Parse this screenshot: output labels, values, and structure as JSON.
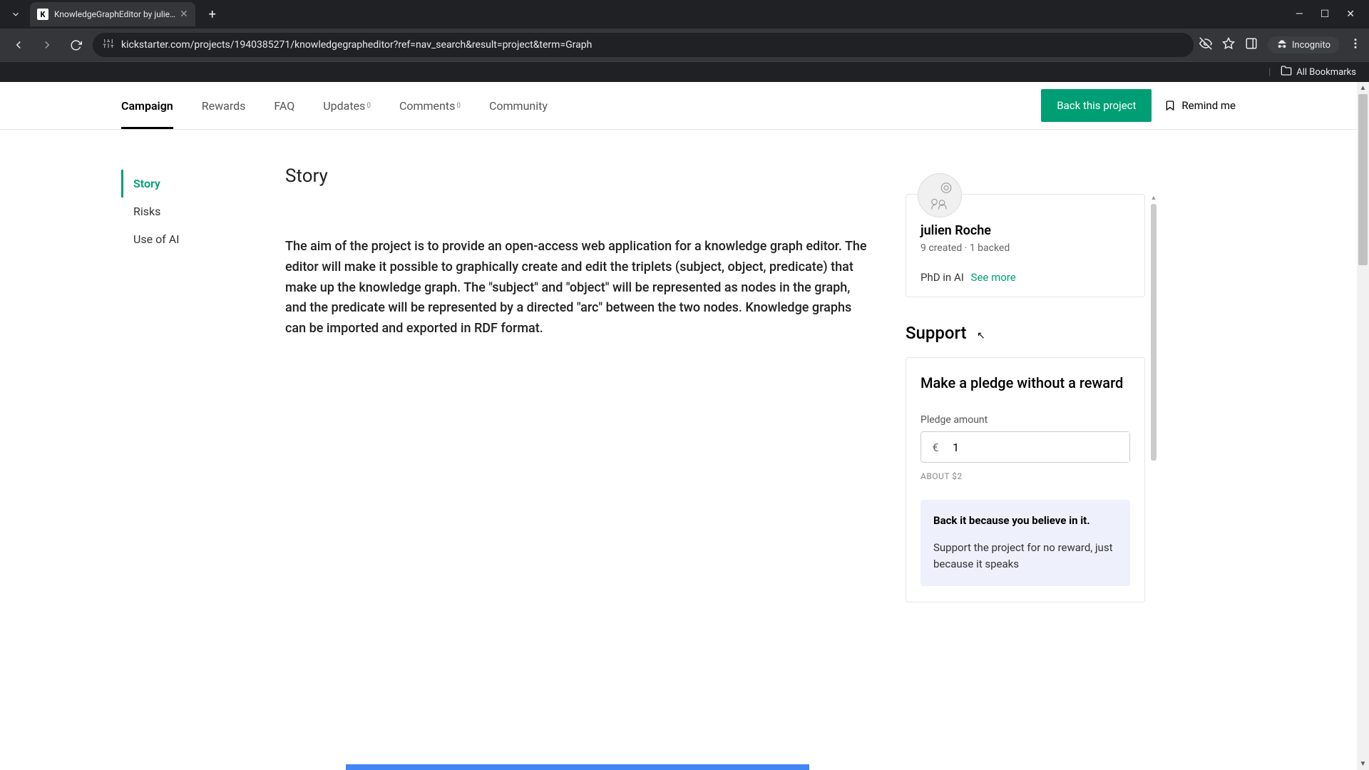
{
  "browser": {
    "tab_title": "KnowledgeGraphEditor by julie…",
    "url": "kickstarter.com/projects/1940385271/knowledgegrapheditor?ref=nav_search&result=project&term=Graph",
    "incognito_label": "Incognito",
    "all_bookmarks": "All Bookmarks"
  },
  "nav": {
    "tabs": {
      "campaign": "Campaign",
      "rewards": "Rewards",
      "faq": "FAQ",
      "updates": "Updates",
      "updates_count": "0",
      "comments": "Comments",
      "comments_count": "0",
      "community": "Community"
    },
    "back_button": "Back this project",
    "remind_button": "Remind me"
  },
  "sidebar": {
    "story": "Story",
    "risks": "Risks",
    "use_of_ai": "Use of AI"
  },
  "story": {
    "heading": "Story",
    "body": "The aim of the project is to provide an open-access web application for a knowledge graph editor. The editor will make it possible to graphically create and edit the triplets (subject, object, predicate) that make up the knowledge graph. The \"subject\" and \"object\" will be represented as nodes in the graph, and the predicate will be represented by a directed \"arc\" between the two nodes. Knowledge graphs can be imported and exported in RDF format."
  },
  "creator": {
    "name": "julien Roche",
    "stats": "9 created · 1 backed",
    "bio": "PhD in AI",
    "see_more": "See more"
  },
  "support": {
    "heading": "Support",
    "pledge_title": "Make a pledge without a reward",
    "pledge_label": "Pledge amount",
    "currency": "€",
    "amount": "1",
    "about": "ABOUT $2",
    "info_title": "Back it because you believe in it.",
    "info_body": "Support the project for no reward, just because it speaks"
  }
}
